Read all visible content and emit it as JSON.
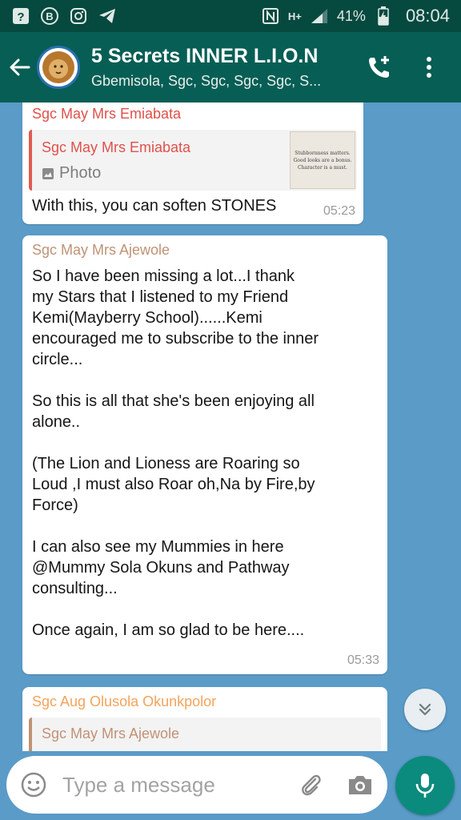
{
  "status_bar": {
    "left_icons": [
      "help-icon",
      "messenger-icon",
      "instagram-icon",
      "telegram-icon"
    ],
    "network": "H+",
    "battery": "41%",
    "time": "08:04"
  },
  "header": {
    "title": "5 Secrets INNER L.I.O.N",
    "subtitle": "Gbemisola, Sgc, Sgc, Sgc, Sgc, S...",
    "accent": "#075e54"
  },
  "messages": [
    {
      "sender": "Sgc May Mrs Emiabata",
      "quote": {
        "sender": "Sgc May Mrs Emiabata",
        "type": "Photo"
      },
      "thumbnail_lines": [
        "Stubbornness matters.",
        "Good looks are a bonus.",
        "Character is a must."
      ],
      "text": "With this, you can soften STONES",
      "time": "05:23"
    },
    {
      "sender": "Sgc May Mrs Ajewole",
      "text": "So I have been missing a lot...I thank\nmy Stars that  I listened to my Friend\nKemi(Mayberry School)......Kemi\nencouraged me to subscribe to the inner\ncircle...\n\nSo this is all that she's been enjoying all\nalone..\n\n(The Lion and Lioness are Roaring so\nLoud ,I must also Roar oh,Na by Fire,by\nForce)\n\nI can also see my Mummies in here\n@Mummy Sola Okuns and Pathway\nconsulting...\n\nOnce again, I am so glad to be here....",
      "time": "05:33"
    },
    {
      "sender": "Sgc Aug Olusola Okunkpolor",
      "quote": {
        "sender": "Sgc May Mrs Ajewole"
      }
    }
  ],
  "input": {
    "placeholder": "Type a message"
  }
}
